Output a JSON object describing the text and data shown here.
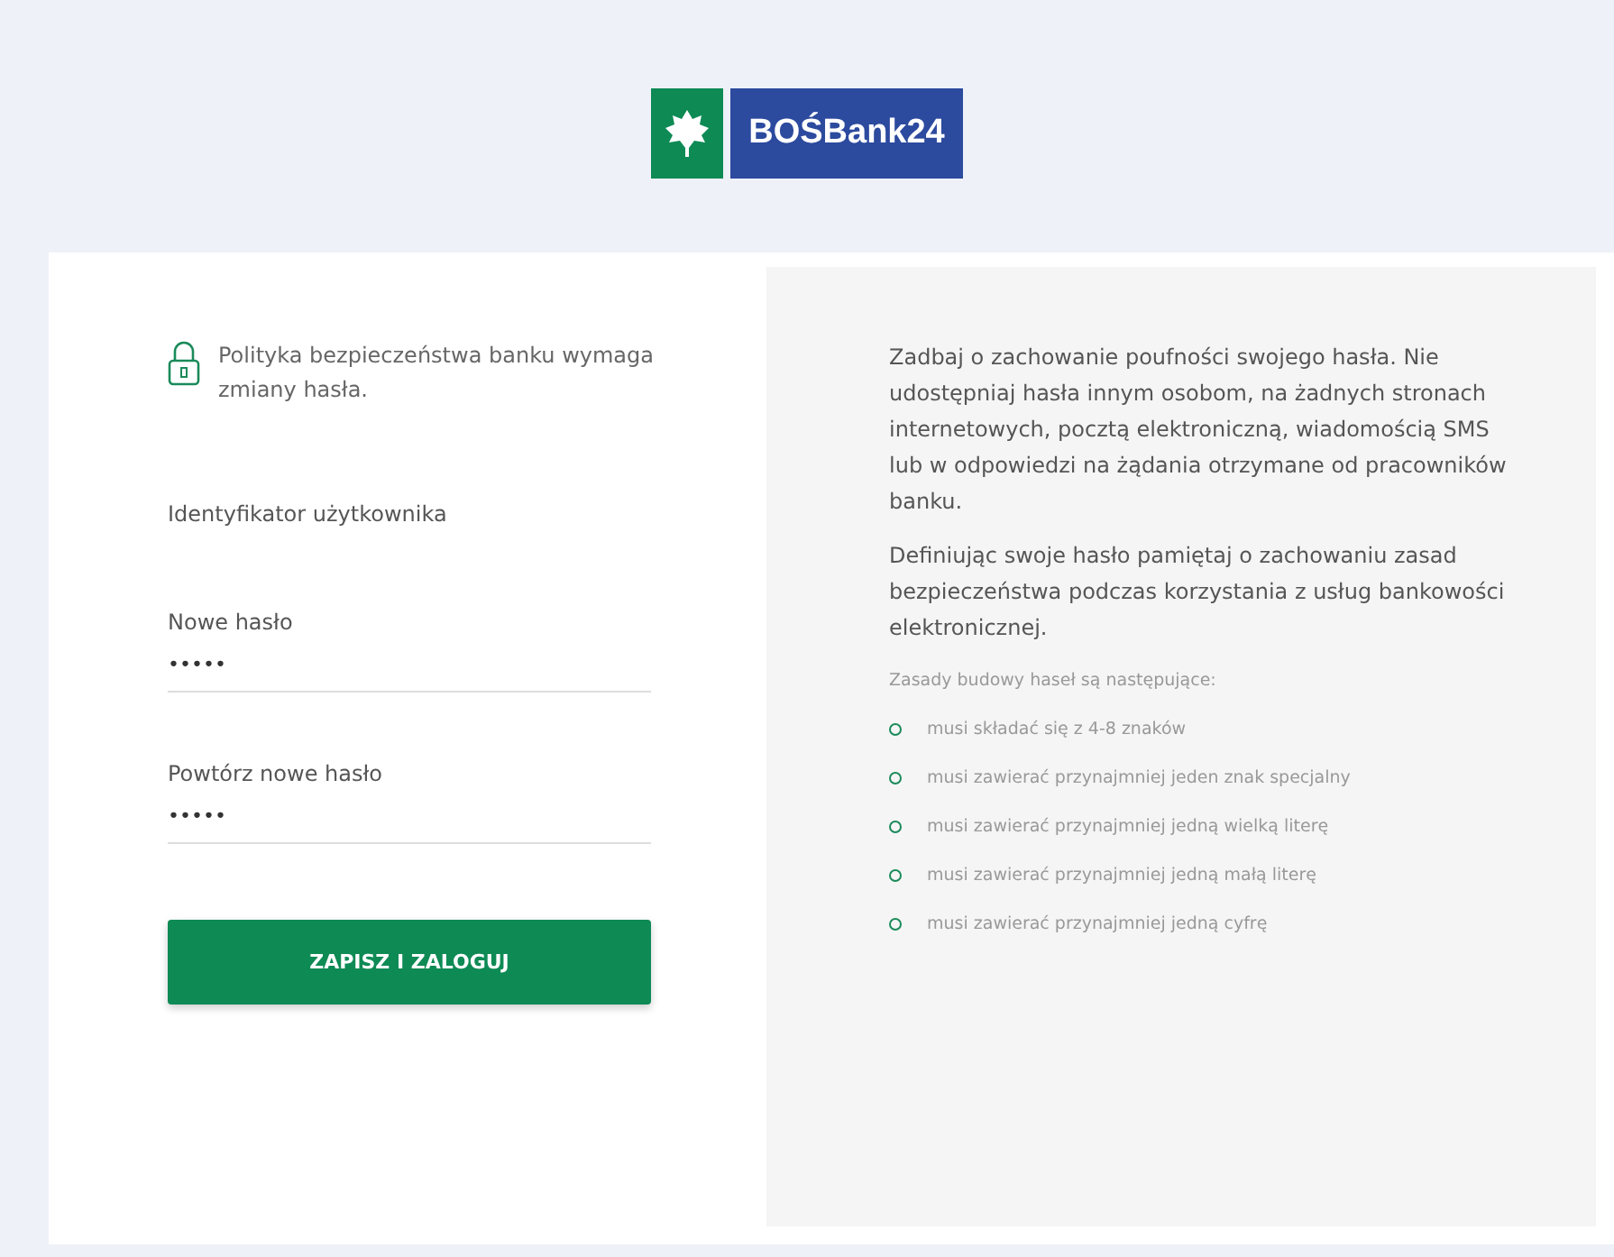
{
  "logo": {
    "text": "BOŚBank24"
  },
  "notice": "Polityka bezpieczeństwa banku wymaga zmiany hasła.",
  "fields": [
    {
      "label": "Identyfikator użytkownika"
    },
    {
      "label": "Nowe hasło",
      "value": "•••••"
    },
    {
      "label": "Powtórz nowe hasło",
      "value": "•••••"
    }
  ],
  "submit": "ZAPISZ I ZALOGUJ",
  "info": [
    "Zadbaj o zachowanie poufności swojego hasła. Nie udostępniaj hasła innym osobom, na żadnych stronach internetowych, pocztą elektroniczną, wiadomością SMS lub w odpowiedzi na żądania otrzymane od pracowników banku.",
    "Definiując swoje hasło pamiętaj o zachowaniu zasad bezpieczeństwa podczas korzystania z usług bankowości elektronicznej."
  ],
  "rules_title": "Zasady budowy haseł są następujące:",
  "rules": [
    "musi składać się z 4-8 znaków",
    "musi zawierać przynajmniej jeden znak specjalny",
    "musi zawierać przynajmniej jedną wielką literę",
    "musi zawierać przynajmniej jedną małą literę",
    "musi zawierać przynajmniej jedną cyfrę"
  ]
}
